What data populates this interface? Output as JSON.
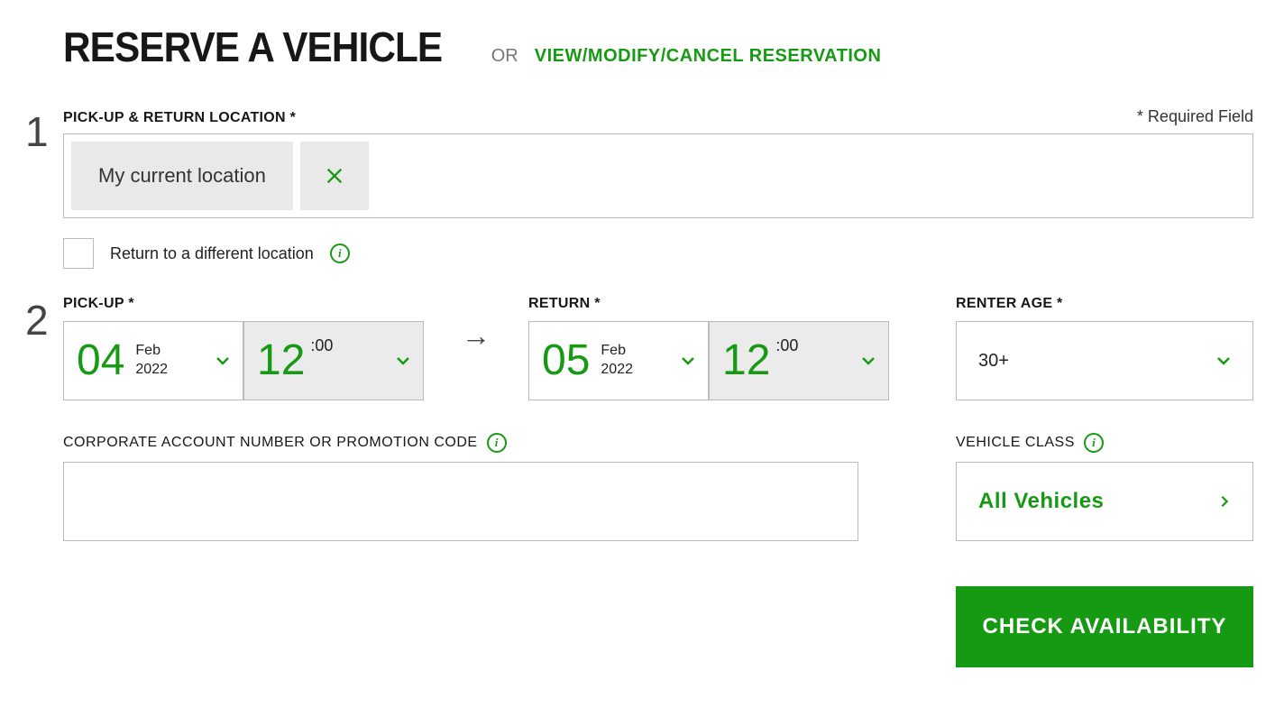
{
  "header": {
    "title": "RESERVE A VEHICLE",
    "or": "OR",
    "link": "VIEW/MODIFY/CANCEL RESERVATION"
  },
  "step1": {
    "number": "1",
    "label": "PICK-UP & RETURN LOCATION *",
    "required_note": "* Required Field",
    "location_chip": "My current location",
    "different_location": "Return to a different location"
  },
  "step2": {
    "number": "2",
    "pickup": {
      "label": "PICK-UP *",
      "day": "04",
      "month": "Feb",
      "year": "2022",
      "hour": "12",
      "minutes": ":00"
    },
    "return": {
      "label": "RETURN *",
      "day": "05",
      "month": "Feb",
      "year": "2022",
      "hour": "12",
      "minutes": ":00"
    },
    "renter_age": {
      "label": "RENTER AGE *",
      "value": "30+"
    }
  },
  "promo": {
    "label": "CORPORATE ACCOUNT NUMBER OR PROMOTION CODE",
    "value": ""
  },
  "vehicle": {
    "label": "VEHICLE CLASS",
    "value": "All Vehicles"
  },
  "cta": "CHECK AVAILABILITY",
  "info_glyph": "i"
}
